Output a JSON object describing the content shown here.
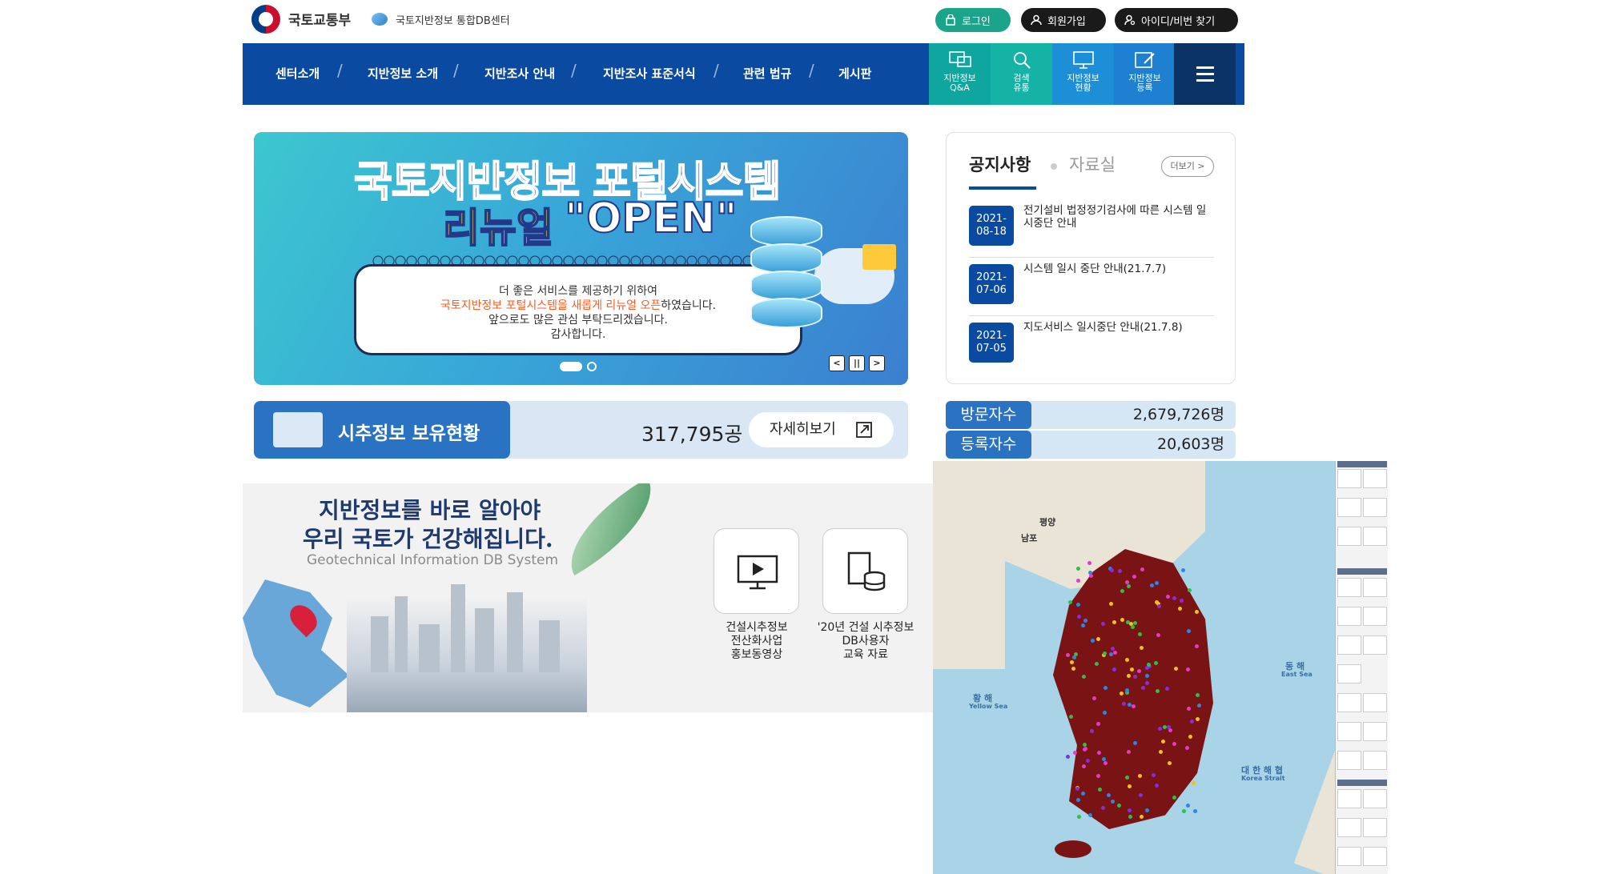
{
  "header": {
    "ministry": "국토교통부",
    "site_name": "국토지반정보 통합DB센터",
    "login_label": "로그인",
    "join_label": "회원가입",
    "find_label": "아이디/비번 찾기"
  },
  "nav": {
    "items": [
      {
        "label": "센터소개"
      },
      {
        "label": "지반정보 소개"
      },
      {
        "label": "지반조사 안내"
      },
      {
        "label": "지반조사 표준서식"
      },
      {
        "label": "관련 법규"
      },
      {
        "label": "게시판"
      }
    ],
    "quick": [
      {
        "line1": "지반정보",
        "line2": "Q&A",
        "color": "#10a6a0",
        "icon": "qa-icon"
      },
      {
        "line1": "검색",
        "line2": "유통",
        "color": "#15b3a6",
        "icon": "search-icon"
      },
      {
        "line1": "지반정보",
        "line2": "현황",
        "color": "#1d8fd6",
        "icon": "monitor-icon"
      },
      {
        "line1": "지반정보",
        "line2": "등록",
        "color": "#1f7fd0",
        "icon": "register-icon"
      }
    ]
  },
  "banner": {
    "title_line1": "국토지반정보 포털시스템",
    "title_line2a": "리뉴얼",
    "title_line2b": "\"OPEN\"",
    "note_line1": "더 좋은 서비스를 제공하기 위하여",
    "note_line2_highlight": "국토지반정보 포털시스템을 새롭게 리뉴얼 오픈",
    "note_line2_rest": "하였습니다.",
    "note_line3": "앞으로도 많은 관심 부탁드리겠습니다.",
    "note_line4": "감사합니다."
  },
  "notice": {
    "tab_active": "공지사항",
    "tab_other": "자료실",
    "more_label": "더보기 >",
    "items": [
      {
        "date1": "2021-",
        "date2": "08-18",
        "title": "전기설비 법정정기검사에 따른 시스템 일시중단 안내"
      },
      {
        "date1": "2021-",
        "date2": "07-06",
        "title": "시스템 일시 중단 안내(21.7.7)"
      },
      {
        "date1": "2021-",
        "date2": "07-05",
        "title": "지도서비스 일시중단 안내(21.7.8)"
      }
    ]
  },
  "holdings": {
    "label": "시추정보 보유현황",
    "value": "317,795공",
    "detail_label": "자세히보기"
  },
  "counts": {
    "visitors_label": "방문자수",
    "visitors_value": "2,679,726명",
    "registered_label": "등록자수",
    "registered_value": "20,603명"
  },
  "promo": {
    "headline1": "지반정보를 바로 알아야",
    "headline2": "우리 국토가 건강해집니다.",
    "subtitle": "Geotechnical Information DB System",
    "card1": {
      "l1": "건설시추정보",
      "l2": "전산화사업",
      "l3": "홍보동영상"
    },
    "card2": {
      "l1": "'20년 건설 시추정보",
      "l2": "DB사용자",
      "l3": "교육 자료"
    }
  },
  "map": {
    "labels": {
      "pyongyang": "평양",
      "namp": "남포",
      "yellow_sea": "황 해",
      "yellow_sea_en": "Yellow Sea",
      "east_sea": "동 해",
      "east_sea_en": "East Sea",
      "korea_strait": "대 한 해 협",
      "korea_strait_en": "Korea Strait"
    }
  }
}
